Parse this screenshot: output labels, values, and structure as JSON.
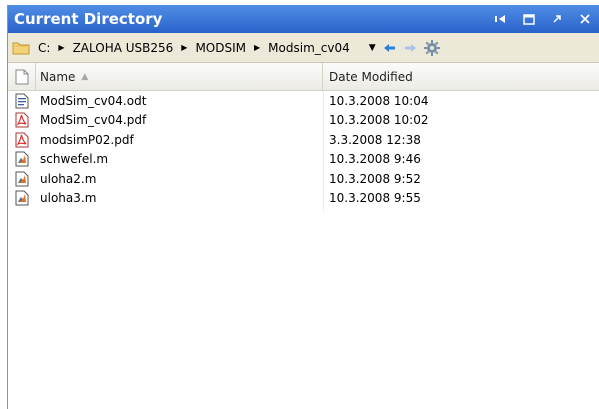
{
  "window": {
    "title": "Current Directory"
  },
  "address": {
    "segments": [
      "C:",
      "ZALOHA USB256",
      "MODSIM",
      "Modsim_cv04"
    ]
  },
  "columns": {
    "name": "Name",
    "date": "Date Modified"
  },
  "files": [
    {
      "name": "ModSim_cv04.odt",
      "date": "10.3.2008 10:04",
      "icon": "odt-document-icon"
    },
    {
      "name": "ModSim_cv04.pdf",
      "date": "10.3.2008 10:02",
      "icon": "pdf-file-icon"
    },
    {
      "name": "modsimP02.pdf",
      "date": "3.3.2008 12:38",
      "icon": "pdf-file-icon"
    },
    {
      "name": "schwefel.m",
      "date": "10.3.2008 9:46",
      "icon": "matlab-file-icon"
    },
    {
      "name": "uloha2.m",
      "date": "10.3.2008 9:52",
      "icon": "matlab-file-icon"
    },
    {
      "name": "uloha3.m",
      "date": "10.3.2008 9:55",
      "icon": "matlab-file-icon"
    }
  ]
}
